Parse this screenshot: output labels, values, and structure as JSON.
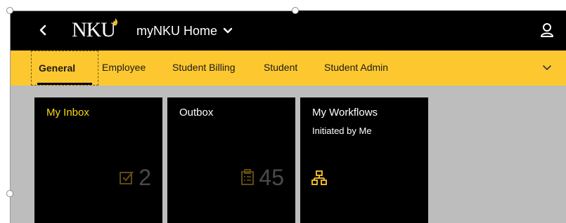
{
  "header": {
    "back_icon": "chevron-left-icon",
    "logo_text": "NKU",
    "title": "myNKU Home",
    "title_dropdown_icon": "chevron-down-icon",
    "user_icon": "user-icon"
  },
  "tabs": [
    {
      "label": "General",
      "active": true
    },
    {
      "label": "Employee",
      "active": false
    },
    {
      "label": "Student Billing",
      "active": false
    },
    {
      "label": "Student",
      "active": false
    },
    {
      "label": "Student Admin",
      "active": false
    }
  ],
  "tabs_overflow_icon": "chevron-down-icon",
  "tiles": {
    "inbox": {
      "title": "My Inbox",
      "count": "2",
      "icon": "checkbox-icon"
    },
    "outbox": {
      "title": "Outbox",
      "count": "45",
      "icon": "clipboard-icon"
    },
    "workflows": {
      "title": "My Workflows",
      "subtitle": "Initiated by Me",
      "icon": "org-chart-icon"
    }
  },
  "colors": {
    "header_bg": "#000000",
    "tab_bar_bg": "#fdc82f",
    "tile_bg": "#000000",
    "accent_yellow": "#fdd90e",
    "content_bg": "#bdbdbd"
  }
}
